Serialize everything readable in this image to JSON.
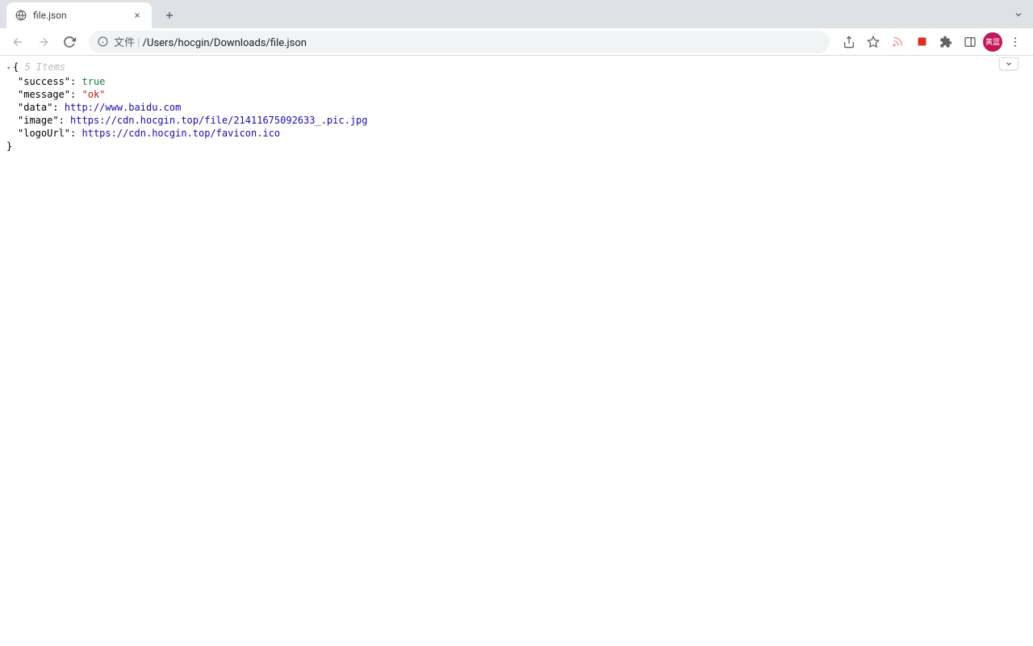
{
  "browser": {
    "tab_title": "file.json",
    "omnibox_scheme": "文件",
    "omnibox_path": "/Users/hocgin/Downloads/file.json",
    "profile_label": "黄蓝"
  },
  "json_view": {
    "hint": "5 Items",
    "entries": [
      {
        "key": "success",
        "type": "bool",
        "value": "true"
      },
      {
        "key": "message",
        "type": "str",
        "value": "ok"
      },
      {
        "key": "data",
        "type": "link",
        "value": "http://www.baidu.com"
      },
      {
        "key": "image",
        "type": "link",
        "value": "https://cdn.hocgin.top/file/21411675092633_.pic.jpg"
      },
      {
        "key": "logoUrl",
        "type": "link",
        "value": "https://cdn.hocgin.top/favicon.ico"
      }
    ]
  }
}
